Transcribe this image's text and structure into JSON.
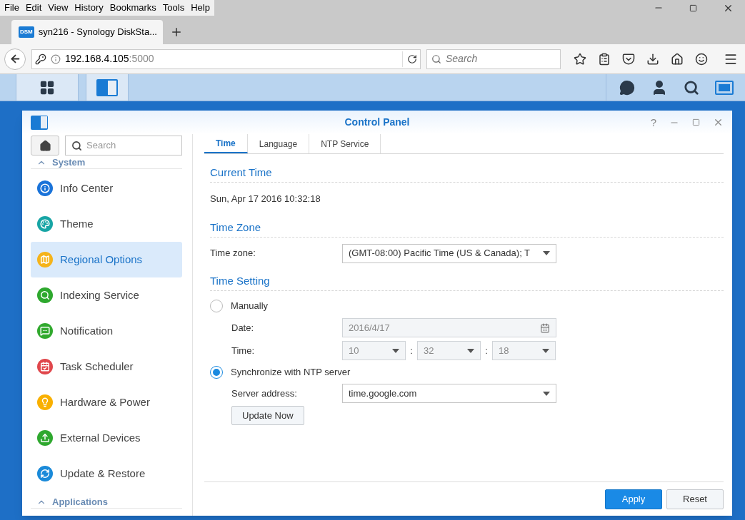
{
  "browser": {
    "menu": [
      "File",
      "Edit",
      "View",
      "History",
      "Bookmarks",
      "Tools",
      "Help"
    ],
    "tab": {
      "favicon": "DSM",
      "title": "syn216 - Synology DiskSta..."
    },
    "url": {
      "host": "192.168.4.105",
      "port": ":5000"
    },
    "search": {
      "placeholder": "Search"
    }
  },
  "window": {
    "title": "Control Panel",
    "help": "?",
    "sidebar": {
      "search": {
        "placeholder": "Search"
      },
      "sections": [
        {
          "label": "System",
          "items": [
            {
              "label": "Info Center",
              "selected": false
            },
            {
              "label": "Theme",
              "selected": false
            },
            {
              "label": "Regional Options",
              "selected": true
            },
            {
              "label": "Indexing Service",
              "selected": false
            },
            {
              "label": "Notification",
              "selected": false
            },
            {
              "label": "Task Scheduler",
              "selected": false
            },
            {
              "label": "Hardware & Power",
              "selected": false
            },
            {
              "label": "External Devices",
              "selected": false
            },
            {
              "label": "Update & Restore",
              "selected": false
            }
          ]
        },
        {
          "label": "Applications"
        }
      ]
    },
    "tabs": [
      {
        "label": "Time",
        "selected": true
      },
      {
        "label": "Language",
        "selected": false
      },
      {
        "label": "NTP Service",
        "selected": false
      }
    ],
    "current_time": {
      "heading": "Current Time",
      "value": "Sun, Apr 17 2016 10:32:18"
    },
    "time_zone": {
      "heading": "Time Zone",
      "label": "Time zone:",
      "value": "(GMT-08:00) Pacific Time (US & Canada); T"
    },
    "time_setting": {
      "heading": "Time Setting",
      "manual": {
        "label": "Manually",
        "selected": false,
        "date_label": "Date:",
        "date": {
          "value": "2016/4/17",
          "disabled": true
        },
        "time_label": "Time:",
        "time": [
          {
            "value": "10",
            "disabled": true
          },
          {
            "value": "32",
            "disabled": true
          },
          {
            "value": "18",
            "disabled": true
          }
        ],
        "separators": [
          ":",
          ":"
        ]
      },
      "ntp": {
        "label": "Synchronize with NTP server",
        "selected": true,
        "server_label": "Server address:",
        "server": "time.google.com",
        "update_button": "Update Now"
      }
    },
    "buttons": [
      {
        "label": "Apply",
        "kind": "primary"
      },
      {
        "label": "Reset",
        "kind": "secondary"
      }
    ]
  }
}
